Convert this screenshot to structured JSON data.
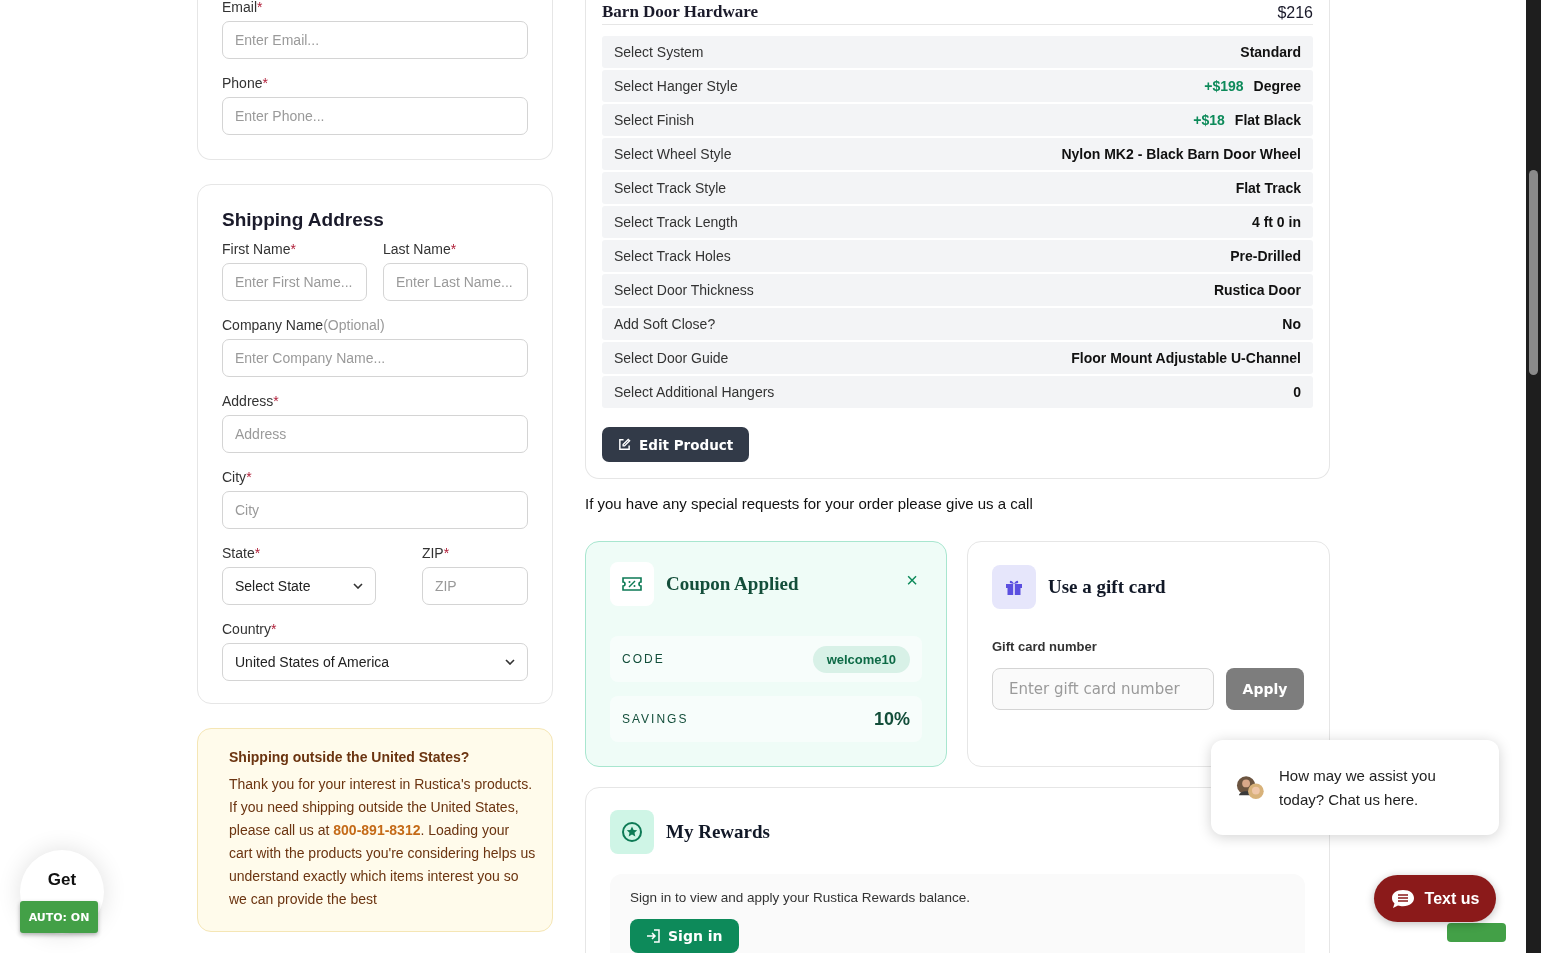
{
  "contact": {
    "fields": [
      {
        "label": "Email",
        "mark": "*",
        "placeholder": "Enter Email..."
      },
      {
        "label": "Phone",
        "mark": "*",
        "placeholder": "Enter Phone..."
      }
    ]
  },
  "shipping": {
    "title": "Shipping Address",
    "rows": [
      [
        {
          "kind": "input",
          "label": "First Name",
          "mark": "*",
          "placeholder": "Enter First Name..."
        },
        {
          "kind": "input",
          "label": "Last Name",
          "mark": "*",
          "placeholder": "Enter Last Name..."
        }
      ],
      [
        {
          "kind": "input",
          "label": "Company Name",
          "note": "(Optional)",
          "placeholder": "Enter Company Name..."
        }
      ],
      [
        {
          "kind": "input",
          "label": "Address",
          "mark": "*",
          "placeholder": "Address"
        }
      ],
      [
        {
          "kind": "input",
          "label": "City",
          "mark": "*",
          "placeholder": "City"
        }
      ],
      [
        {
          "kind": "select",
          "label": "State",
          "mark": "*",
          "value": "Select State"
        },
        {
          "kind": "input",
          "label": "ZIP",
          "mark": "*",
          "placeholder": "ZIP"
        }
      ],
      [
        {
          "kind": "select",
          "label": "Country",
          "mark": "*",
          "value": "United States of America"
        }
      ]
    ]
  },
  "notice": {
    "title": "Shipping outside the United States?",
    "text": "Thank you for your interest in Rustica's products. If you need shipping outside the United States, please call us at **800-891-8312**. Loading your cart with the products you're considering helps us understand exactly which items interest you so we can provide the best"
  },
  "product": {
    "title": "Barn Door Hardware",
    "price": "$216",
    "options": [
      {
        "label": "Select System",
        "value": "Standard"
      },
      {
        "label": "Select Hanger Style",
        "surcharge": "+$198",
        "value": "Degree"
      },
      {
        "label": "Select Finish",
        "surcharge": "+$18",
        "value": "Flat Black"
      },
      {
        "label": "Select Wheel Style",
        "value": "Nylon MK2 - Black Barn Door Wheel"
      },
      {
        "label": "Select Track Style",
        "value": "Flat Track"
      },
      {
        "label": "Select Track Length",
        "value": "4 ft 0 in"
      },
      {
        "label": "Select Track Holes",
        "value": "Pre-Drilled"
      },
      {
        "label": "Select Door Thickness",
        "value": "Rustica Door"
      },
      {
        "label": "Add Soft Close?",
        "value": "No"
      },
      {
        "label": "Select Door Guide",
        "value": "Floor Mount Adjustable U-Channel"
      },
      {
        "label": "Select Additional Hangers",
        "value": "0"
      }
    ],
    "edit_button": "Edit Product"
  },
  "special_request": "If you have any special requests for your order please give us a call",
  "coupon": {
    "title": "Coupon Applied",
    "close": "×",
    "code_label": "CODE",
    "code": "welcome10",
    "savings_label": "SAVINGS",
    "savings": "10%"
  },
  "gift_card": {
    "title": "Use a gift card",
    "field_label": "Gift card number",
    "placeholder": "Enter gift card number",
    "button": "Apply",
    "disabled": true
  },
  "rewards": {
    "title": "My Rewards",
    "text": "Sign in to view and apply your Rustica Rewards balance.",
    "button": "Sign in"
  },
  "chat": {
    "message": "How may we assist you today? Chat us here.",
    "button": "Text us"
  },
  "promo": {
    "text": "Get",
    "badge": "AUTO: ON"
  }
}
